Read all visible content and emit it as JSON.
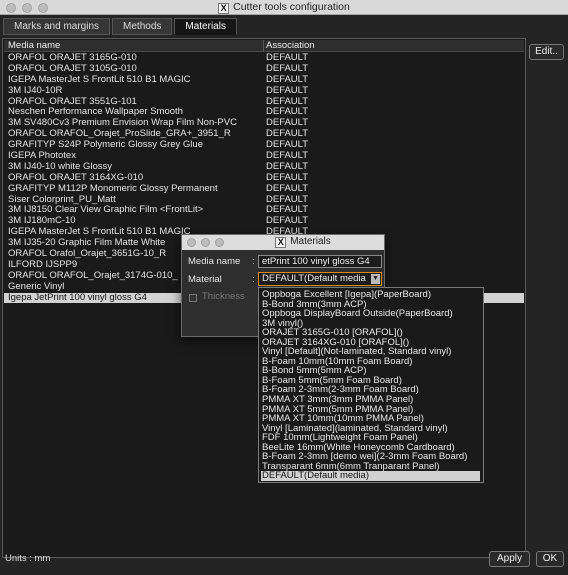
{
  "window": {
    "title": "Cutter tools configuration"
  },
  "tabs": [
    {
      "label": "Marks and margins",
      "active": false
    },
    {
      "label": "Methods",
      "active": false
    },
    {
      "label": "Materials",
      "active": true
    }
  ],
  "table": {
    "columns": [
      "Media name",
      "Association"
    ],
    "rows": [
      {
        "name": "ORAFOL ORAJET 3165G-010",
        "assoc": "DEFAULT"
      },
      {
        "name": "ORAFOL ORAJET 3105G-010",
        "assoc": "DEFAULT"
      },
      {
        "name": "IGEPA MasterJet S FrontLit 510 B1 MAGIC",
        "assoc": "DEFAULT"
      },
      {
        "name": "3M IJ40-10R",
        "assoc": "DEFAULT"
      },
      {
        "name": "ORAFOL ORAJET 3551G-101",
        "assoc": "DEFAULT"
      },
      {
        "name": "Neschen Performance Wallpaper Smooth",
        "assoc": "DEFAULT"
      },
      {
        "name": "3M SV480Cv3 Premium Envision Wrap Film Non-PVC",
        "assoc": "DEFAULT"
      },
      {
        "name": "ORAFOL ORAFOL_Orajet_ProSlide_GRA+_3951_R",
        "assoc": "DEFAULT"
      },
      {
        "name": "GRAFITYP S24P Polymeric Glossy Grey Glue",
        "assoc": "DEFAULT"
      },
      {
        "name": "IGEPA Phototex",
        "assoc": "DEFAULT"
      },
      {
        "name": "3M IJ40-10 white Glossy",
        "assoc": "DEFAULT"
      },
      {
        "name": "ORAFOL ORAJET 3164XG-010",
        "assoc": "DEFAULT"
      },
      {
        "name": "GRAFITYP M112P Monomeric Glossy Permanent",
        "assoc": "DEFAULT"
      },
      {
        "name": "Siser Colorprint_PU_Matt",
        "assoc": "DEFAULT"
      },
      {
        "name": "3M IJ8150  Clear View Graphic Film  <FrontLit>",
        "assoc": "DEFAULT"
      },
      {
        "name": "3M IJ180mC-10",
        "assoc": "DEFAULT"
      },
      {
        "name": "IGEPA MasterJet S FrontLit 510 B1 MAGIC",
        "assoc": "DEFAULT"
      },
      {
        "name": "3M IJ35-20 Graphic Film Matte White",
        "assoc": "DEFAULT"
      },
      {
        "name": "ORAFOL Orafol_Orajet_3651G-10_R",
        "assoc": "DEFAULT"
      },
      {
        "name": "ILFORD IJSPP9",
        "assoc": "DEFAULT"
      },
      {
        "name": "ORAFOL ORAFOL_Orajet_3174G-010_",
        "assoc": "DEFAULT"
      },
      {
        "name": "Generic Vinyl",
        "assoc": "DEFAULT"
      },
      {
        "name": "Igepa JetPrint 100 vinyl gloss G4",
        "assoc": ""
      }
    ]
  },
  "buttons": {
    "edit": "Edit..",
    "apply": "Apply",
    "ok": "OK"
  },
  "status": {
    "units": "Units : mm"
  },
  "dialog": {
    "title": "Materials",
    "media_label": "Media name",
    "media_value": "etPrint 100 vinyl gloss G4",
    "material_label": "Material",
    "material_value": "DEFAULT(Default media",
    "thickness_label": "Thickness",
    "colon": ":"
  },
  "dropdown": {
    "items": [
      "Oppboga Excellent [Igepa](PaperBoard)",
      "B-Bond 3mm(3mm ACP)",
      "Oppboga DisplayBoard Outside(PaperBoard)",
      "3M vinyl()",
      "ORAJET 3165G-010 [ORAFOL]()",
      "ORAJET 3164XG-010 [ORAFOL]()",
      "Vinyl [Default](Not-laminated, Standard vinyl)",
      "B-Foam 10mm(10mm Foam Board)",
      "B-Bond 5mm(5mm ACP)",
      "B-Foam 5mm(5mm Foam Board)",
      "B-Foam 2-3mm(2-3mm Foam Board)",
      "PMMA XT 3mm(3mm PMMA Panel)",
      "PMMA XT 5mm(5mm PMMA Panel)",
      "PMMA XT 10mm(10mm PMMA Panel)",
      "Vinyl [Laminated](laminated, Standard vinyl)",
      "FDF 10mm(Lightweight Foam Panel)",
      "BeeLite 16mm(White Honeycomb Cardboard)",
      "B-Foam 2-3mm [demo wei](2-3mm Foam Board)",
      "Transparant 6mm(6mm Tranparant Panel)",
      "DEFAULT(Default media)"
    ],
    "selected": "DEFAULT(Default media)"
  }
}
